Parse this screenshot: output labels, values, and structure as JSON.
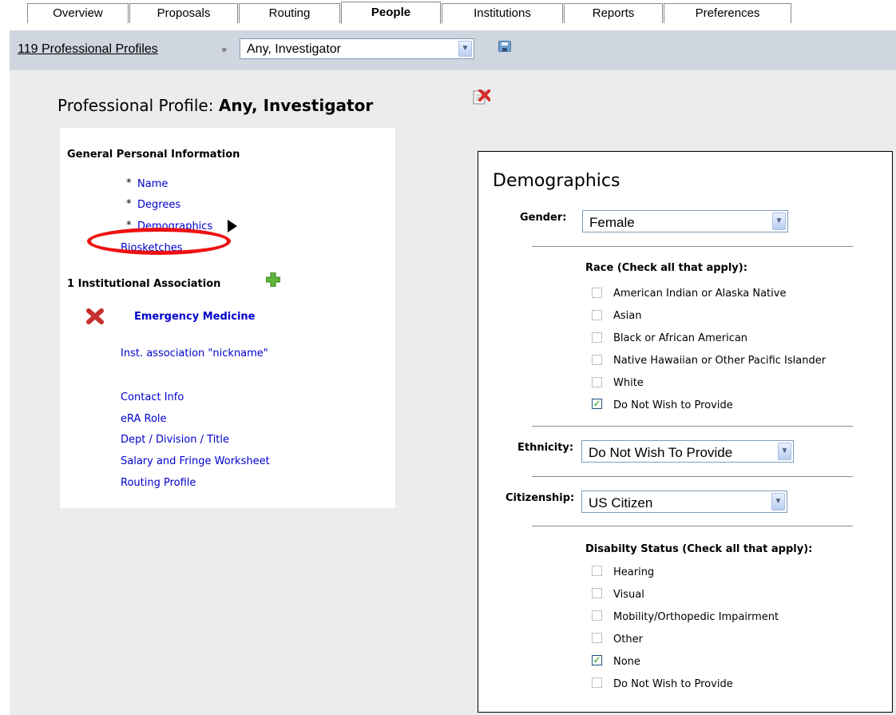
{
  "tabs": [
    {
      "label": "Overview"
    },
    {
      "label": "Proposals"
    },
    {
      "label": "Routing"
    },
    {
      "label": "People"
    },
    {
      "label": "Institutions"
    },
    {
      "label": "Reports"
    },
    {
      "label": "Preferences"
    }
  ],
  "active_tab": "People",
  "topbar": {
    "profiles_link": "119 Professional Profiles",
    "separator": "»",
    "profile_select": "Any, Investigator"
  },
  "page": {
    "title_prefix": "Professional Profile:",
    "title_name": "Any, Investigator"
  },
  "left_panel": {
    "general_heading": "General Personal Information",
    "items": [
      {
        "star": "*",
        "label": "Name"
      },
      {
        "star": "*",
        "label": "Degrees"
      },
      {
        "star": "*",
        "label": "Demographics"
      },
      {
        "star": "",
        "label": "Biosketches"
      }
    ],
    "institution_heading": "1 Institutional Association",
    "institution_name": "Emergency Medicine",
    "nickname_link": "Inst. association \"nickname\"",
    "sub_links": [
      {
        "label": "Contact Info"
      },
      {
        "label": "eRA Role"
      },
      {
        "label": "Dept / Division / Title"
      },
      {
        "label": "Salary and Fringe Worksheet"
      },
      {
        "label": "Routing Profile"
      }
    ]
  },
  "demographics": {
    "title": "Demographics",
    "gender_label": "Gender:",
    "gender_value": "Female",
    "race_label": "Race (Check all that apply):",
    "race_options": [
      {
        "label": "American Indian or Alaska Native",
        "checked": false
      },
      {
        "label": "Asian",
        "checked": false
      },
      {
        "label": "Black or African American",
        "checked": false
      },
      {
        "label": "Native Hawaiian or Other Pacific Islander",
        "checked": false
      },
      {
        "label": "White",
        "checked": false
      },
      {
        "label": "Do Not Wish to Provide",
        "checked": true
      }
    ],
    "ethnicity_label": "Ethnicity:",
    "ethnicity_value": "Do Not Wish To Provide",
    "citizenship_label": "Citizenship:",
    "citizenship_value": "US Citizen",
    "disability_label": "Disabilty Status (Check all that apply):",
    "disability_options": [
      {
        "label": "Hearing",
        "checked": false
      },
      {
        "label": "Visual",
        "checked": false
      },
      {
        "label": "Mobility/Orthopedic Impairment",
        "checked": false
      },
      {
        "label": "Other",
        "checked": false
      },
      {
        "label": "None",
        "checked": true
      },
      {
        "label": "Do Not Wish to Provide",
        "checked": false
      }
    ]
  },
  "colors": {
    "link": "#0000cc",
    "topbar": "#cfd6df",
    "background": "#ececec",
    "highlight_ellipse": "#ee1111"
  }
}
